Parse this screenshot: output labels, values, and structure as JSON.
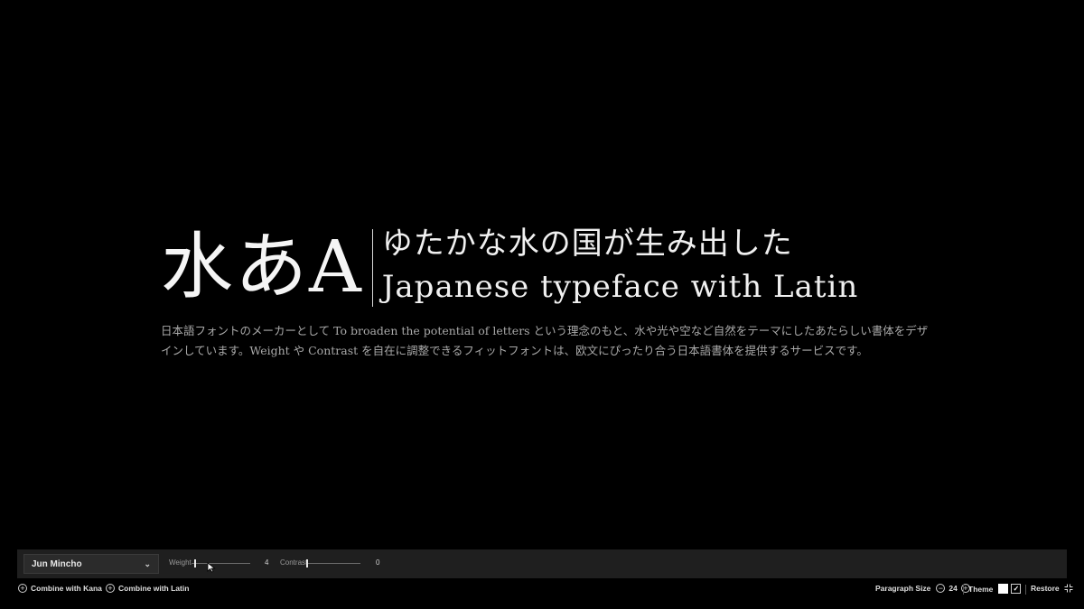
{
  "specimen": {
    "glyphs": "水あA",
    "line1": "ゆたかな水の国が生み出した",
    "line2": "Japanese typeface with Latin",
    "paragraph": "日本語フォントのメーカーとして To broaden the potential of letters という理念のもと、水や光や空など自然をテーマにしたあたらしい書体をデザインしています。Weight や Contrast を自在に調整できるフィットフォントは、欧文にぴったり合う日本語書体を提供するサービスです。"
  },
  "controls": {
    "font": "Jun Mincho",
    "weight_label": "Weight",
    "weight_value": "4",
    "weight_fraction": 0.04,
    "contrast_label": "Contrast",
    "contrast_value": "0",
    "contrast_fraction": 0.0
  },
  "bottom": {
    "combine_kana": "Combine with Kana",
    "combine_latin": "Combine with Latin",
    "paragraph_size_label": "Paragraph Size",
    "paragraph_size_value": "24",
    "theme_label": "Theme",
    "restore_label": "Restore"
  },
  "icons": {
    "add": "plus-circle-icon",
    "decrease": "minus-circle-icon",
    "increase": "plus-circle-icon",
    "dropdown": "chevron-down-icon",
    "theme_selected": "check-icon",
    "restore": "compress-icon"
  },
  "colors": {
    "background": "#000000",
    "bar": "#1f1f1f",
    "text": "#f2f2f2",
    "muted": "#a9a9a9"
  }
}
